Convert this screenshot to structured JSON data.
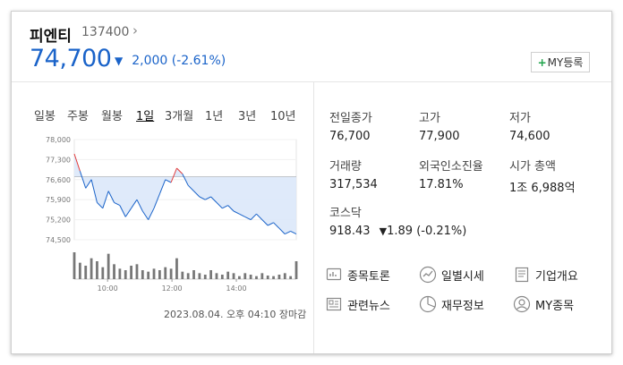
{
  "stock": {
    "name": "피엔티",
    "code": "137400",
    "price": "74,700",
    "change": "2,000",
    "change_pct": "(-2.61%)",
    "my_button": "MY등록",
    "colors": {
      "down": "#1a63c9",
      "up": "#e23b3b"
    }
  },
  "tabs": [
    "일봉",
    "주봉",
    "월봉",
    "1일",
    "3개월",
    "1년",
    "3년",
    "10년"
  ],
  "selected_tab": "1일",
  "chart_data": {
    "type": "area",
    "ylim": [
      74500,
      78000
    ],
    "yticks": [
      "78,000",
      "77,300",
      "76,600",
      "75,900",
      "75,200",
      "74,500"
    ],
    "xticks": [
      "10:00",
      "12:00",
      "14:00"
    ],
    "baseline": 76700,
    "x": [
      "09:00",
      "09:10",
      "09:20",
      "09:30",
      "09:40",
      "09:50",
      "10:00",
      "10:10",
      "10:20",
      "10:30",
      "10:40",
      "10:50",
      "11:00",
      "11:10",
      "11:20",
      "11:30",
      "11:40",
      "11:50",
      "12:00",
      "12:10",
      "12:20",
      "12:30",
      "12:40",
      "12:50",
      "13:00",
      "13:10",
      "13:20",
      "13:30",
      "13:40",
      "13:50",
      "14:00",
      "14:10",
      "14:20",
      "14:30",
      "14:40",
      "14:50",
      "15:00",
      "15:10",
      "15:20",
      "15:30"
    ],
    "values": [
      77500,
      76900,
      76300,
      76600,
      75800,
      75600,
      76200,
      75800,
      75700,
      75300,
      75600,
      75900,
      75500,
      75200,
      75600,
      76100,
      76600,
      76500,
      77000,
      76800,
      76400,
      76200,
      76000,
      75900,
      76000,
      75800,
      75600,
      75700,
      75500,
      75400,
      75300,
      75200,
      75400,
      75200,
      75000,
      75100,
      74900,
      74700,
      74800,
      74700
    ],
    "volume": [
      0.9,
      0.55,
      0.45,
      0.7,
      0.6,
      0.4,
      0.85,
      0.5,
      0.35,
      0.3,
      0.45,
      0.5,
      0.3,
      0.25,
      0.35,
      0.3,
      0.4,
      0.35,
      0.7,
      0.25,
      0.2,
      0.3,
      0.2,
      0.15,
      0.3,
      0.2,
      0.15,
      0.25,
      0.2,
      0.1,
      0.2,
      0.15,
      0.1,
      0.2,
      0.12,
      0.1,
      0.15,
      0.2,
      0.1,
      0.6
    ]
  },
  "datetime": "2023.08.04. 오후 04:10 장마감",
  "stats": [
    {
      "label": "전일종가",
      "value": "76,700",
      "tone": "normal"
    },
    {
      "label": "고가",
      "value": "77,900",
      "tone": "red"
    },
    {
      "label": "저가",
      "value": "74,600",
      "tone": "normal"
    },
    {
      "label": "거래량",
      "value": "317,534",
      "tone": "normal"
    },
    {
      "label": "외국인소진율",
      "value": "17.81%",
      "tone": "normal"
    },
    {
      "label": "시가 총액",
      "value": "1조 6,988억",
      "tone": "normal"
    }
  ],
  "index": {
    "name": "코스닥",
    "value": "918.43",
    "change": "1.89",
    "change_pct": "(-0.21%)"
  },
  "links": [
    {
      "label": "종목토론",
      "icon": "discussion-icon"
    },
    {
      "label": "일별시세",
      "icon": "daily-chart-icon"
    },
    {
      "label": "기업개요",
      "icon": "document-icon"
    },
    {
      "label": "관련뉴스",
      "icon": "news-icon"
    },
    {
      "label": "재무정보",
      "icon": "pie-chart-icon"
    },
    {
      "label": "MY종목",
      "icon": "person-icon"
    }
  ]
}
